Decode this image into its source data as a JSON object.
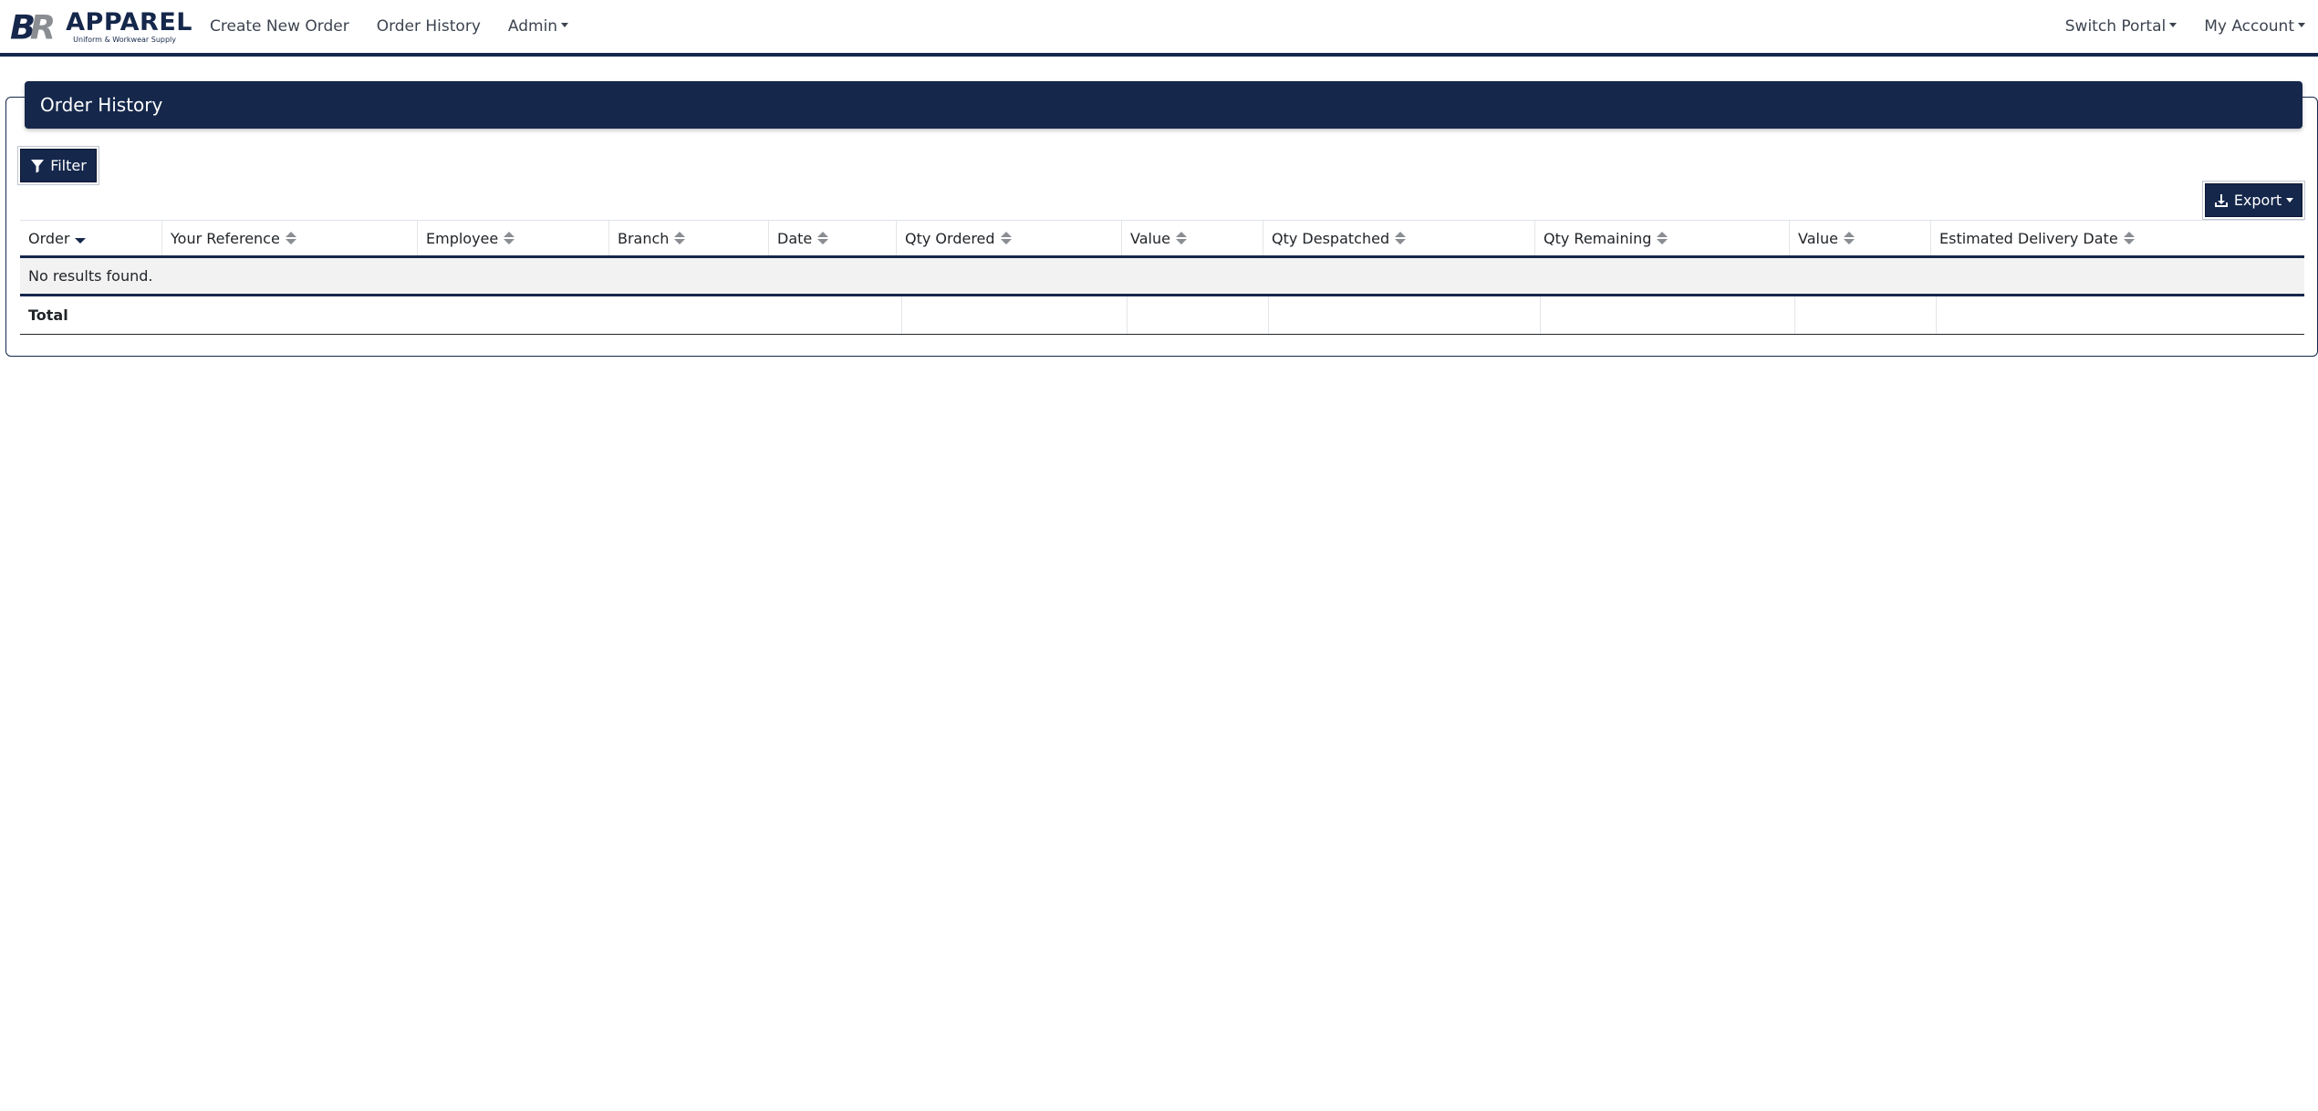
{
  "brand": {
    "word": "APPAREL",
    "tagline": "Uniform & Workwear Supply",
    "colors": {
      "navy": "#15274b",
      "grey": "#8a8d92"
    }
  },
  "nav": {
    "links": [
      "Create New Order",
      "Order History",
      "Admin"
    ],
    "right": [
      "Switch Portal",
      "My Account"
    ]
  },
  "page": {
    "title": "Order History",
    "filter_label": "Filter",
    "export_label": "Export"
  },
  "table": {
    "columns": [
      "Order",
      "Your Reference",
      "Employee",
      "Branch",
      "Date",
      "Qty Ordered",
      "Value",
      "Qty Despatched",
      "Qty Remaining",
      "Value",
      "Estimated Delivery Date"
    ],
    "empty_message": "No results found.",
    "footer_label": "Total"
  }
}
